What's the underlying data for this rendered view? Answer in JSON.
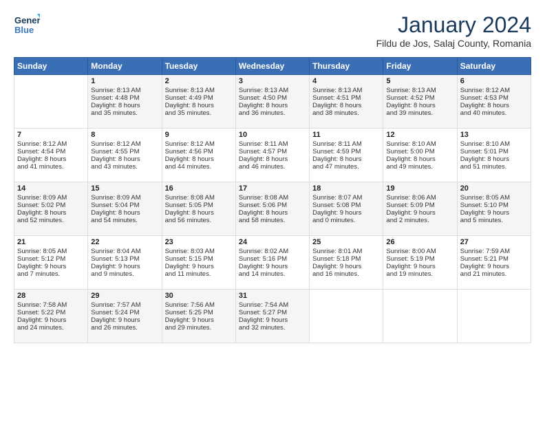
{
  "header": {
    "logo_line1": "General",
    "logo_line2": "Blue",
    "month": "January 2024",
    "location": "Fildu de Jos, Salaj County, Romania"
  },
  "weekdays": [
    "Sunday",
    "Monday",
    "Tuesday",
    "Wednesday",
    "Thursday",
    "Friday",
    "Saturday"
  ],
  "weeks": [
    [
      {
        "day": "",
        "content": ""
      },
      {
        "day": "1",
        "content": "Sunrise: 8:13 AM\nSunset: 4:48 PM\nDaylight: 8 hours\nand 35 minutes."
      },
      {
        "day": "2",
        "content": "Sunrise: 8:13 AM\nSunset: 4:49 PM\nDaylight: 8 hours\nand 35 minutes."
      },
      {
        "day": "3",
        "content": "Sunrise: 8:13 AM\nSunset: 4:50 PM\nDaylight: 8 hours\nand 36 minutes."
      },
      {
        "day": "4",
        "content": "Sunrise: 8:13 AM\nSunset: 4:51 PM\nDaylight: 8 hours\nand 38 minutes."
      },
      {
        "day": "5",
        "content": "Sunrise: 8:13 AM\nSunset: 4:52 PM\nDaylight: 8 hours\nand 39 minutes."
      },
      {
        "day": "6",
        "content": "Sunrise: 8:12 AM\nSunset: 4:53 PM\nDaylight: 8 hours\nand 40 minutes."
      }
    ],
    [
      {
        "day": "7",
        "content": "Sunrise: 8:12 AM\nSunset: 4:54 PM\nDaylight: 8 hours\nand 41 minutes."
      },
      {
        "day": "8",
        "content": "Sunrise: 8:12 AM\nSunset: 4:55 PM\nDaylight: 8 hours\nand 43 minutes."
      },
      {
        "day": "9",
        "content": "Sunrise: 8:12 AM\nSunset: 4:56 PM\nDaylight: 8 hours\nand 44 minutes."
      },
      {
        "day": "10",
        "content": "Sunrise: 8:11 AM\nSunset: 4:57 PM\nDaylight: 8 hours\nand 46 minutes."
      },
      {
        "day": "11",
        "content": "Sunrise: 8:11 AM\nSunset: 4:59 PM\nDaylight: 8 hours\nand 47 minutes."
      },
      {
        "day": "12",
        "content": "Sunrise: 8:10 AM\nSunset: 5:00 PM\nDaylight: 8 hours\nand 49 minutes."
      },
      {
        "day": "13",
        "content": "Sunrise: 8:10 AM\nSunset: 5:01 PM\nDaylight: 8 hours\nand 51 minutes."
      }
    ],
    [
      {
        "day": "14",
        "content": "Sunrise: 8:09 AM\nSunset: 5:02 PM\nDaylight: 8 hours\nand 52 minutes."
      },
      {
        "day": "15",
        "content": "Sunrise: 8:09 AM\nSunset: 5:04 PM\nDaylight: 8 hours\nand 54 minutes."
      },
      {
        "day": "16",
        "content": "Sunrise: 8:08 AM\nSunset: 5:05 PM\nDaylight: 8 hours\nand 56 minutes."
      },
      {
        "day": "17",
        "content": "Sunrise: 8:08 AM\nSunset: 5:06 PM\nDaylight: 8 hours\nand 58 minutes."
      },
      {
        "day": "18",
        "content": "Sunrise: 8:07 AM\nSunset: 5:08 PM\nDaylight: 9 hours\nand 0 minutes."
      },
      {
        "day": "19",
        "content": "Sunrise: 8:06 AM\nSunset: 5:09 PM\nDaylight: 9 hours\nand 2 minutes."
      },
      {
        "day": "20",
        "content": "Sunrise: 8:05 AM\nSunset: 5:10 PM\nDaylight: 9 hours\nand 5 minutes."
      }
    ],
    [
      {
        "day": "21",
        "content": "Sunrise: 8:05 AM\nSunset: 5:12 PM\nDaylight: 9 hours\nand 7 minutes."
      },
      {
        "day": "22",
        "content": "Sunrise: 8:04 AM\nSunset: 5:13 PM\nDaylight: 9 hours\nand 9 minutes."
      },
      {
        "day": "23",
        "content": "Sunrise: 8:03 AM\nSunset: 5:15 PM\nDaylight: 9 hours\nand 11 minutes."
      },
      {
        "day": "24",
        "content": "Sunrise: 8:02 AM\nSunset: 5:16 PM\nDaylight: 9 hours\nand 14 minutes."
      },
      {
        "day": "25",
        "content": "Sunrise: 8:01 AM\nSunset: 5:18 PM\nDaylight: 9 hours\nand 16 minutes."
      },
      {
        "day": "26",
        "content": "Sunrise: 8:00 AM\nSunset: 5:19 PM\nDaylight: 9 hours\nand 19 minutes."
      },
      {
        "day": "27",
        "content": "Sunrise: 7:59 AM\nSunset: 5:21 PM\nDaylight: 9 hours\nand 21 minutes."
      }
    ],
    [
      {
        "day": "28",
        "content": "Sunrise: 7:58 AM\nSunset: 5:22 PM\nDaylight: 9 hours\nand 24 minutes."
      },
      {
        "day": "29",
        "content": "Sunrise: 7:57 AM\nSunset: 5:24 PM\nDaylight: 9 hours\nand 26 minutes."
      },
      {
        "day": "30",
        "content": "Sunrise: 7:56 AM\nSunset: 5:25 PM\nDaylight: 9 hours\nand 29 minutes."
      },
      {
        "day": "31",
        "content": "Sunrise: 7:54 AM\nSunset: 5:27 PM\nDaylight: 9 hours\nand 32 minutes."
      },
      {
        "day": "",
        "content": ""
      },
      {
        "day": "",
        "content": ""
      },
      {
        "day": "",
        "content": ""
      }
    ]
  ]
}
